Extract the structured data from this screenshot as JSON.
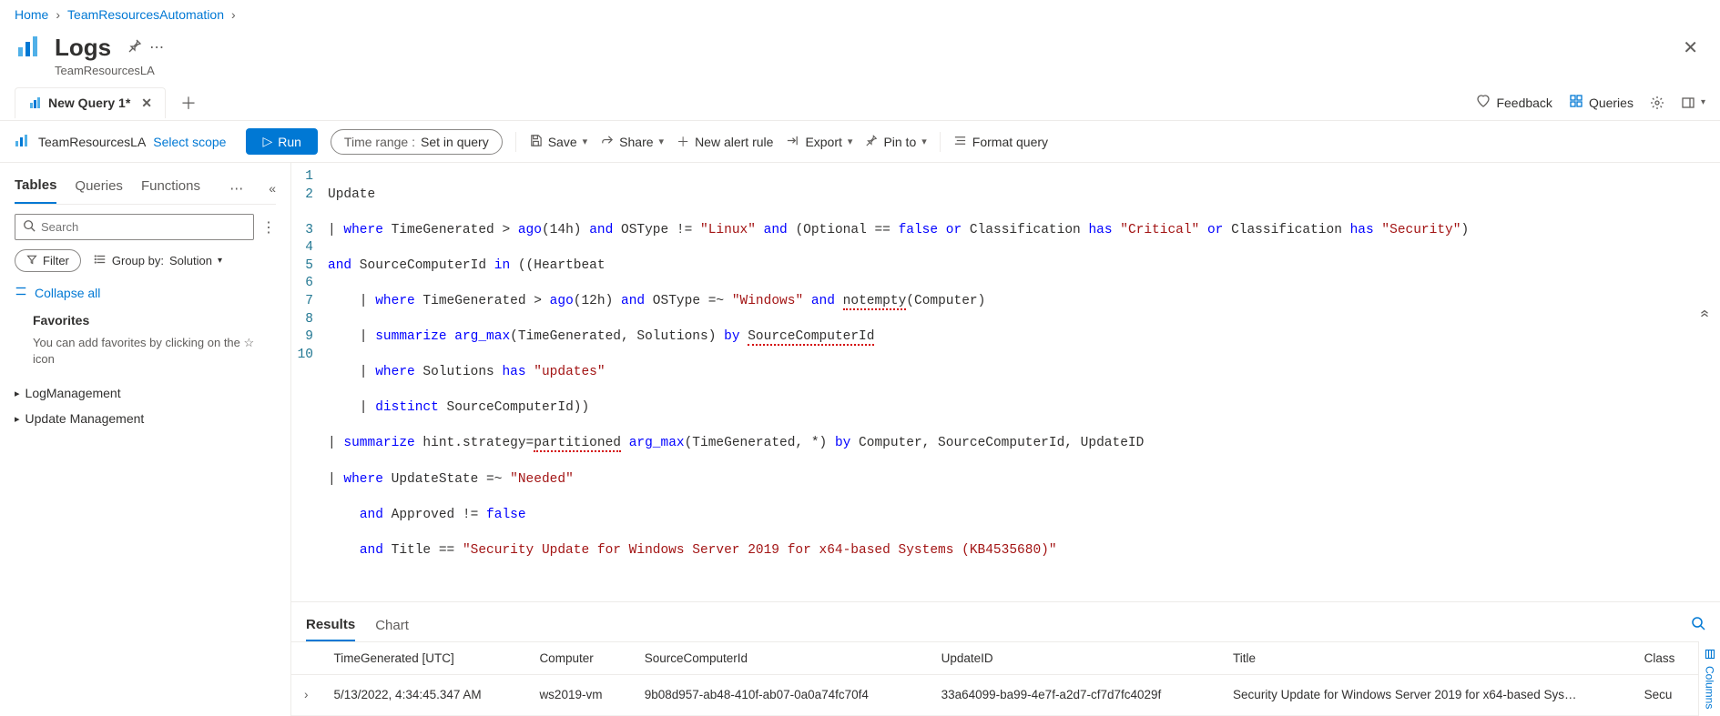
{
  "breadcrumb": {
    "home": "Home",
    "resource": "TeamResourcesAutomation"
  },
  "header": {
    "title": "Logs",
    "subtitle": "TeamResourcesLA"
  },
  "tabs": {
    "query_tab": "New Query 1*"
  },
  "topRight": {
    "feedback": "Feedback",
    "queries": "Queries"
  },
  "toolbar": {
    "scope_name": "TeamResourcesLA",
    "select_scope": "Select scope",
    "run": "Run",
    "time_label": "Time range :",
    "time_value": "Set in query",
    "save": "Save",
    "share": "Share",
    "new_alert": "New alert rule",
    "export": "Export",
    "pin_to": "Pin to",
    "format": "Format query"
  },
  "sidebar": {
    "tabs": {
      "tables": "Tables",
      "queries": "Queries",
      "functions": "Functions"
    },
    "search_placeholder": "Search",
    "filter": "Filter",
    "groupby_label": "Group by:",
    "groupby_value": "Solution",
    "collapse_all": "Collapse all",
    "favorites": "Favorites",
    "favorites_hint": "You can add favorites by clicking on the ☆ icon",
    "tree": {
      "log_mgmt": "LogManagement",
      "update_mgmt": "Update Management"
    }
  },
  "query": {
    "lines": [
      "1",
      "2",
      "3",
      "4",
      "5",
      "6",
      "7",
      "8",
      "9",
      "10"
    ],
    "l1": "Update",
    "l2a": "| ",
    "l2b": "where",
    "l2c": " TimeGenerated > ",
    "l2d": "ago",
    "l2e": "(14h) ",
    "l2f": "and",
    "l2g": " OSType != ",
    "l2h": "\"Linux\"",
    "l2i": " and",
    "l2j": " (Optional == ",
    "l2k": "false",
    "l2l": " or",
    "l2m": " Classification ",
    "l2n": "has",
    "l2o": " \"Critical\"",
    "l2p": " or",
    "l2q": " Classification ",
    "l2r": "has",
    "l2s": " \"Security\"",
    "l2t": ")",
    "l2_5a": "and",
    "l2_5b": " SourceComputerId ",
    "l2_5c": "in",
    "l2_5d": " ((Heartbeat",
    "l3a": "    | ",
    "l3b": "where",
    "l3c": " TimeGenerated > ",
    "l3d": "ago",
    "l3e": "(12h) ",
    "l3f": "and",
    "l3g": " OSType =~ ",
    "l3h": "\"Windows\"",
    "l3i": " and",
    "l3j": " ",
    "l3k": "notempty",
    "l3l": "(Computer)",
    "l4a": "    | ",
    "l4b": "summarize",
    "l4c": " ",
    "l4d": "arg_max",
    "l4e": "(TimeGenerated, Solutions) ",
    "l4f": "by",
    "l4g": " ",
    "l4h": "SourceComputerId",
    "l5a": "    | ",
    "l5b": "where",
    "l5c": " Solutions ",
    "l5d": "has",
    "l5e": " \"updates\"",
    "l6a": "    | ",
    "l6b": "distinct",
    "l6c": " SourceComputerId))",
    "l7a": "| ",
    "l7b": "summarize",
    "l7c": " hint.strategy=",
    "l7d": "partitioned",
    "l7e": " ",
    "l7f": "arg_max",
    "l7g": "(TimeGenerated, *) ",
    "l7h": "by",
    "l7i": " Computer, SourceComputerId, UpdateID",
    "l8a": "| ",
    "l8b": "where",
    "l8c": " UpdateState =~ ",
    "l8d": "\"Needed\"",
    "l9a": "    ",
    "l9b": "and",
    "l9c": " Approved != ",
    "l9d": "false",
    "l10a": "    ",
    "l10b": "and",
    "l10c": " Title == ",
    "l10d": "\"Security Update for Windows Server 2019 for x64-based Systems (KB4535680)\""
  },
  "results": {
    "tabs": {
      "results": "Results",
      "chart": "Chart"
    },
    "columns": {
      "time": "TimeGenerated [UTC]",
      "computer": "Computer",
      "source": "SourceComputerId",
      "updateid": "UpdateID",
      "title": "Title",
      "classification": "Class"
    },
    "row": {
      "time": "5/13/2022, 4:34:45.347 AM",
      "computer": "ws2019-vm",
      "source": "9b08d957-ab48-410f-ab07-0a0a74fc70f4",
      "updateid": "33a64099-ba99-4e7f-a2d7-cf7d7fc4029f",
      "title": "Security Update for Windows Server 2019 for x64-based Sys…",
      "classification": "Secu"
    },
    "columns_tab": "Columns"
  }
}
